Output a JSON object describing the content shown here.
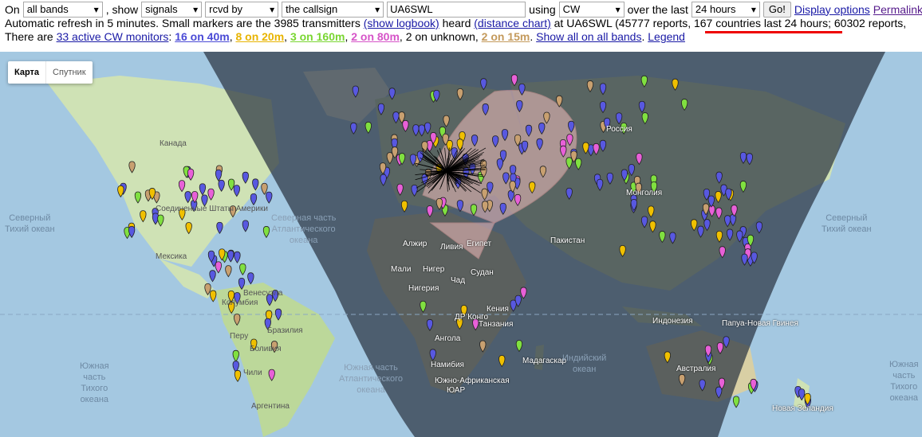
{
  "row1": {
    "on_label": "On",
    "bands_select": "all bands",
    "show_label": ", show",
    "show_select": "signals",
    "rcvd_select": "rcvd by",
    "callsign_select": "the callsign",
    "callsign_value": "UA6SWL",
    "using_label": "using",
    "mode_select": "CW",
    "over_label": "over the last",
    "period_select": "24 hours",
    "go_button": "Go!",
    "display_options": "Display options",
    "permalink": "Permalink"
  },
  "row2": {
    "text1": "Automatic refresh in 5 minutes. Small markers are the 3985 transmitters",
    "show_logbook": "(show logbook)",
    "text2": "heard",
    "distance_chart": "(distance chart)",
    "text3": "at UA6SWL (45777 reports,",
    "countries": "167 countries last 24 hours",
    "text4": "; 60302 reports,"
  },
  "row3": {
    "text1": "There are",
    "monitors": "33 active CW monitors",
    "colon": ":",
    "b40": "16 on 40m",
    "b20": "8 on 20m",
    "b160": "3 on 160m",
    "b80": "2 on 80m",
    "unknown": "2 on unknown",
    "b15": "2 on 15m",
    "sep": ",",
    "dot": ".",
    "show_all": "Show all on all bands",
    "legend": "Legend"
  },
  "map": {
    "type_map": "Карта",
    "type_sat": "Спутник",
    "labels": [
      {
        "t": "Россия"
      },
      {
        "t": "Монголия"
      },
      {
        "t": "Пакистан"
      },
      {
        "t": "Египет"
      },
      {
        "t": "Ливия"
      },
      {
        "t": "Алжир"
      },
      {
        "t": "Мали"
      },
      {
        "t": "Нигер"
      },
      {
        "t": "Чад"
      },
      {
        "t": "Судан"
      },
      {
        "t": "Нигерия"
      },
      {
        "t": "Кения"
      },
      {
        "t": "ДР Конго"
      },
      {
        "t": "Танзания"
      },
      {
        "t": "Ангола"
      },
      {
        "t": "Намибия"
      },
      {
        "t": "ЮАР"
      },
      {
        "t": "Южно-Африканская"
      },
      {
        "t": "Мадагаскар"
      },
      {
        "t": "Индонезия"
      },
      {
        "t": "Австралия"
      },
      {
        "t": "Папуа-Новая Гвинея"
      },
      {
        "t": "Новая Зеландия"
      },
      {
        "t": "Мексика"
      },
      {
        "t": "Венесуэла"
      },
      {
        "t": "Колумбия"
      },
      {
        "t": "Перу"
      },
      {
        "t": "Бразилия"
      },
      {
        "t": "Боливия"
      },
      {
        "t": "Чили"
      },
      {
        "t": "Аргентина"
      },
      {
        "t": "Соединенные Штаты Америки"
      },
      {
        "t": "Канада"
      }
    ],
    "oceans": [
      {
        "t": "Северный\nТихий океан"
      },
      {
        "t": "Северная часть\nАтлантического\nокеана"
      },
      {
        "t": "Южная\nчасть\nТихого\nокеана"
      },
      {
        "t": "Южная часть\nАтлантического\nокеана"
      },
      {
        "t": "Индийский\nокеан"
      },
      {
        "t": "Северный\nТихий океан"
      },
      {
        "t": "Южная\nчасть\nТихого\nокеана"
      }
    ],
    "marker_colors": {
      "40m": "#5858e0",
      "20m": "#f0c000",
      "160m": "#80e040",
      "80m": "#e860d8",
      "15m": "#c8a070",
      "unknown": "#7070ff"
    }
  }
}
